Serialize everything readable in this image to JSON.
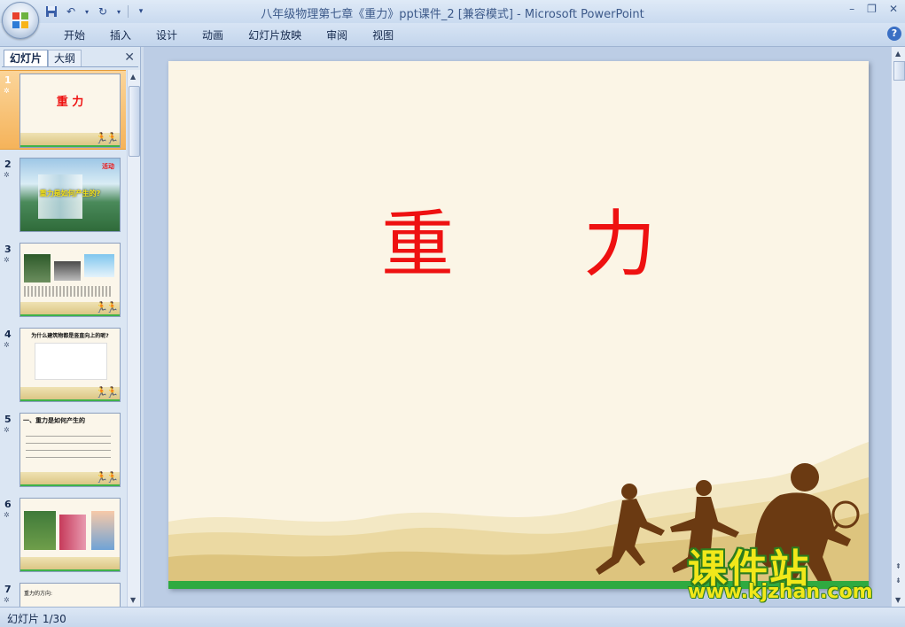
{
  "window": {
    "title": "八年级物理第七章《重力》ppt课件_2 [兼容模式] - Microsoft PowerPoint"
  },
  "ribbon": {
    "tabs": [
      {
        "label": "开始"
      },
      {
        "label": "插入"
      },
      {
        "label": "设计"
      },
      {
        "label": "动画"
      },
      {
        "label": "幻灯片放映"
      },
      {
        "label": "审阅"
      },
      {
        "label": "视图"
      }
    ],
    "help_label": "?"
  },
  "left_pane": {
    "tab_slides": "幻灯片",
    "tab_outline": "大纲",
    "close_glyph": "✕",
    "thumbnails": [
      {
        "num": "1",
        "text": "重 力",
        "selected": true
      },
      {
        "num": "2",
        "text": "重力是如何产生的?",
        "tag": "活动"
      },
      {
        "num": "3",
        "text": ""
      },
      {
        "num": "4",
        "text": "为什么建筑物都是竖直向上的呢?"
      },
      {
        "num": "5",
        "text": "一、重力是如何产生的"
      },
      {
        "num": "6",
        "text": ""
      },
      {
        "num": "7",
        "text": "重力的方向:"
      }
    ]
  },
  "slide": {
    "title": "重 力"
  },
  "status_bar": {
    "slide_indicator": "幻灯片 1/30"
  },
  "watermark": {
    "brand": "课件站",
    "url": "www.kjzhan.com"
  },
  "colors": {
    "title_red": "#ee1111",
    "grass_green": "#2faa40",
    "selected_thumb": "#f5b35a"
  }
}
